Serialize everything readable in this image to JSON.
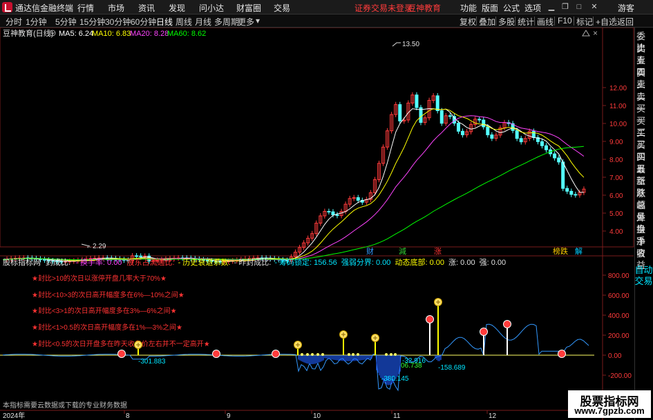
{
  "titlebar": {
    "app_title": "通达信金融终端",
    "menus": [
      "行情",
      "市场",
      "资讯",
      "发现",
      "问小达",
      "财富圈",
      "交易"
    ],
    "notice": "证券交易未登录",
    "brand": "豆神教育",
    "right_menus": [
      "功能",
      "版面",
      "公式",
      "选项"
    ],
    "guest": "游客"
  },
  "periods": [
    "分时",
    "1分钟",
    "5分钟",
    "15分钟",
    "30分钟",
    "60分钟",
    "日线",
    "周线",
    "月线",
    "多周期",
    "更多"
  ],
  "active_period": "日线",
  "right_buttons": [
    "复权",
    "叠加",
    "多股",
    "统计",
    "画线",
    "F10",
    "标记",
    "+自选",
    "返回"
  ],
  "main_chart": {
    "stock_label": "豆神教育(日线)",
    "ma": [
      {
        "name": "MA5:",
        "value": "6.24",
        "color": "#ffffff"
      },
      {
        "name": "MA10:",
        "value": "6.83",
        "color": "#ffff00"
      },
      {
        "name": "MA20:",
        "value": "8.28",
        "color": "#ff44ff"
      },
      {
        "name": "MA60:",
        "value": "8.62",
        "color": "#00ff00"
      }
    ],
    "y_ticks": [
      "12.00",
      "11.00",
      "10.00",
      "9.00",
      "8.00",
      "7.00",
      "6.00",
      "5.00",
      "4.00"
    ],
    "high_label": "13.50",
    "low_label": "2.29",
    "event_marks": [
      {
        "text": "财",
        "color": "#3399ff"
      },
      {
        "text": "減",
        "color": "#33cc33"
      },
      {
        "text": "涨",
        "color": "#ff3333"
      },
      {
        "text": "榜跌",
        "color": "#ffcc00"
      },
      {
        "text": "解",
        "color": "#00ccff"
      }
    ]
  },
  "sub_chart": {
    "header": [
      {
        "text": "股标指标网",
        "color": "#e0e0e0"
      },
      {
        "text": "封成比:",
        "color": "#e0e0e0"
      },
      {
        "text": "- 换手率: 0.00",
        "color": "#ff44ff"
      },
      {
        "text": "股东占流通比: ",
        "color": "#ff3333"
      },
      {
        "text": "- 历史衰退系数: ",
        "color": "#ffff00"
      },
      {
        "text": "- 昨封成比: ",
        "color": "#e0e0e0"
      },
      {
        "text": "- 筹码锁定: 156.56",
        "color": "#00e5ff"
      },
      {
        "text": "强弱分界: 0.00",
        "color": "#00e5ff"
      },
      {
        "text": "动态底部: 0.00",
        "color": "#ffff00"
      },
      {
        "text": "涨: 0.00",
        "color": "#e0e0e0"
      },
      {
        "text": "强: 0.00",
        "color": "#e0e0e0"
      }
    ],
    "notes": [
      "★封比>10的次日以涨停开盘几率大于70%★",
      "★封比<10>3的次日高开幅度多在6%—10%之间★",
      "★封比<3>1的次日高开幅度多在3%—6%之间★",
      "★封比<1>0.5的次日高开幅度多在1%—3%之间★",
      "★封比<0.5的次日开盘多在昨天收盘价左右并不一定高开★"
    ],
    "y_ticks": [
      "800.00",
      "600.00",
      "400.00",
      "200.00",
      "0.00",
      "-200.00"
    ],
    "value_labels": [
      "-301.883",
      "-158.689",
      "-380.145",
      "-32.916",
      "06.738"
    ],
    "footer_note": "本指标需要云数据或下载的专业财务数据"
  },
  "x_axis": [
    "2024年",
    "8",
    "9",
    "10",
    "11",
    "12"
  ],
  "sidebar": [
    "委比",
    "卖五",
    "卖四",
    "卖三",
    "卖二",
    "卖一",
    "买一",
    "买二",
    "买三",
    "买四",
    "买五",
    "最新",
    "涨跌",
    "涨幅",
    "总量",
    "外盘",
    "换手",
    "净资",
    "收益"
  ],
  "sidebar_auto": [
    "自动",
    "交易"
  ],
  "watermark": {
    "line1": "股票指标网",
    "line2": "www.7gpzb.com"
  },
  "colors": {
    "up": "#ff3b3b",
    "down": "#54ffff",
    "bg": "#000000",
    "grid": "#7a1c1c"
  }
}
